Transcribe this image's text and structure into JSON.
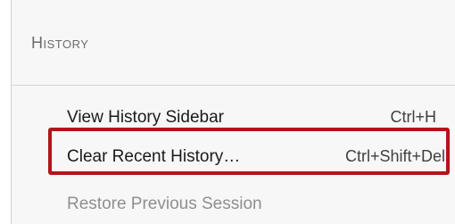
{
  "panel": {
    "title": "History"
  },
  "menu": {
    "items": [
      {
        "label": "View History Sidebar",
        "shortcut": "Ctrl+H",
        "enabled": true
      },
      {
        "label": "Clear Recent History…",
        "shortcut": "Ctrl+Shift+Del",
        "enabled": true
      },
      {
        "label": "Restore Previous Session",
        "shortcut": "",
        "enabled": false
      }
    ]
  },
  "colors": {
    "panel_background": "#f7f7f7",
    "highlight_border": "#b3141b",
    "title_text": "#6c6c6c",
    "disabled_text": "#8f8f8f"
  }
}
